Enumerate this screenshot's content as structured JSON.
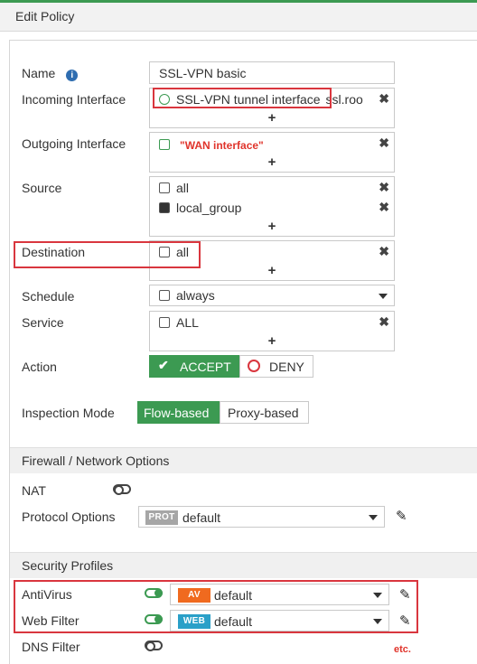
{
  "window": {
    "title": "Edit Policy"
  },
  "form": {
    "name": {
      "label": "Name",
      "value": "SSL-VPN basic"
    },
    "incoming_interface": {
      "label": "Incoming Interface",
      "entry": "SSL-VPN tunnel interface",
      "entry_suffix": "ssl.roo"
    },
    "outgoing_interface": {
      "label": "Outgoing Interface",
      "entry": "\"WAN interface\""
    },
    "source": {
      "label": "Source",
      "entries": [
        "all",
        "local_group"
      ]
    },
    "destination": {
      "label": "Destination",
      "entry": "all"
    },
    "schedule": {
      "label": "Schedule",
      "value": "always"
    },
    "service": {
      "label": "Service",
      "entry": "ALL"
    },
    "action": {
      "label": "Action",
      "accept": "ACCEPT",
      "deny": "DENY",
      "selected": "ACCEPT"
    },
    "inspection_mode": {
      "label": "Inspection Mode",
      "flow": "Flow-based",
      "proxy": "Proxy-based",
      "selected": "Flow-based"
    }
  },
  "firewall_section": {
    "title": "Firewall / Network Options",
    "nat": {
      "label": "NAT",
      "enabled": false
    },
    "protocol_options": {
      "label": "Protocol Options",
      "tag": "PROT",
      "value": "default"
    }
  },
  "security_section": {
    "title": "Security Profiles",
    "antivirus": {
      "label": "AntiVirus",
      "enabled": true,
      "tag": "AV",
      "value": "default"
    },
    "web_filter": {
      "label": "Web Filter",
      "enabled": true,
      "tag": "WEB",
      "value": "default"
    },
    "dns_filter": {
      "label": "DNS Filter",
      "enabled": false
    }
  },
  "annotation": {
    "etc": "etc."
  },
  "colors": {
    "accent_green": "#3c9a52",
    "highlight_red": "#d9363e",
    "av_orange": "#f06a1f",
    "web_blue": "#2aa0c8",
    "prot_gray": "#a6a6a6"
  },
  "plus": "+",
  "close": "✖"
}
